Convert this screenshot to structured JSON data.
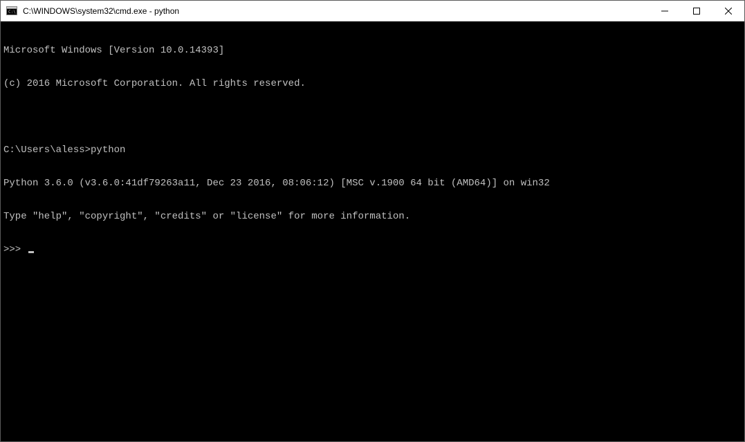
{
  "window": {
    "title": "C:\\WINDOWS\\system32\\cmd.exe - python",
    "icon_name": "cmd-icon"
  },
  "terminal": {
    "lines": {
      "l0": "Microsoft Windows [Version 10.0.14393]",
      "l1": "(c) 2016 Microsoft Corporation. All rights reserved.",
      "l2": "",
      "prompt_path": "C:\\Users\\aless>",
      "prompt_cmd": "python",
      "l4": "Python 3.6.0 (v3.6.0:41df79263a11, Dec 23 2016, 08:06:12) [MSC v.1900 64 bit (AMD64)] on win32",
      "l5": "Type \"help\", \"copyright\", \"credits\" or \"license\" for more information.",
      "repl_prompt": ">>> "
    }
  }
}
